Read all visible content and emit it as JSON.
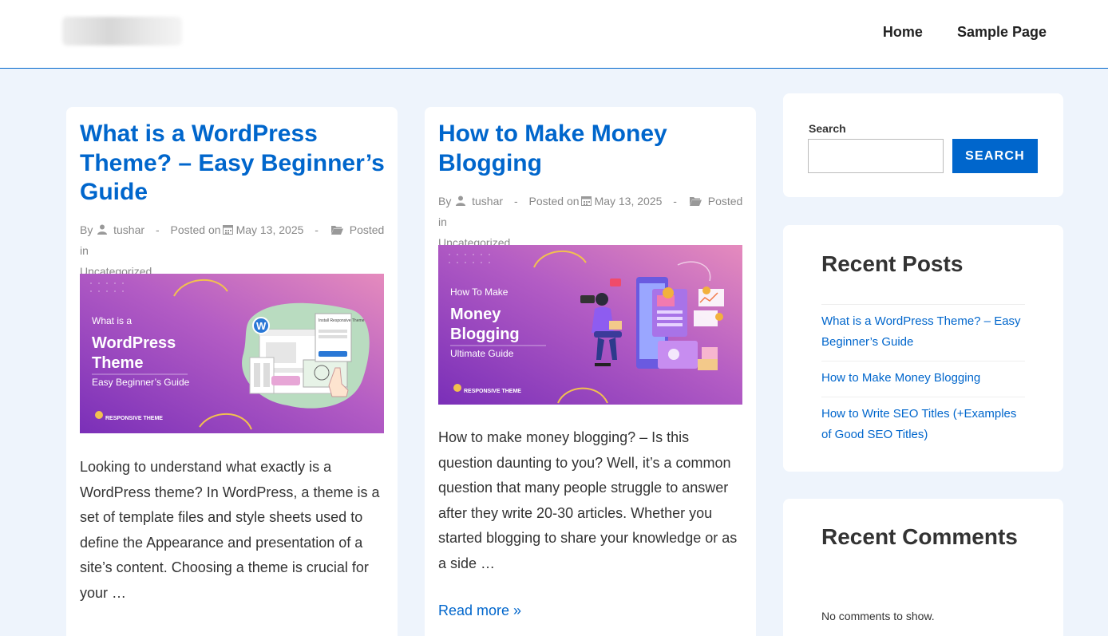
{
  "nav": {
    "items": [
      "Home",
      "Sample Page"
    ]
  },
  "posts": [
    {
      "title": "What is a WordPress Theme? – Easy Beginner’s Guide",
      "meta": {
        "by": "By",
        "author": "tushar",
        "posted_on": "Posted on",
        "date": "May 13, 2025",
        "posted_in": "Posted in",
        "category": "Uncategorized"
      },
      "image": {
        "line1": "What is a",
        "line2": "WordPress",
        "line3": "Theme",
        "line4": "Easy Beginner’s Guide",
        "brand": "RESPONSIVE THEME",
        "popup_title": "Install Responsive Theme"
      },
      "excerpt": "Looking to understand what exactly is a WordPress theme? In WordPress, a theme is a set of template files and style sheets used to define the Appearance and presentation of a site’s content.  Choosing a theme is crucial for your …"
    },
    {
      "title": "How to Make Money Blogging",
      "meta": {
        "by": "By",
        "author": "tushar",
        "posted_on": "Posted on",
        "date": "May 13, 2025",
        "posted_in": "Posted in",
        "category": "Uncategorized"
      },
      "image": {
        "line1": "How To Make",
        "line2": "Money",
        "line3": "Blogging",
        "line4": "Ultimate Guide",
        "brand": "RESPONSIVE THEME"
      },
      "excerpt": "How to make money blogging? – Is this question daunting to you? Well, it’s a common question that many people struggle to answer after they write 20-30 articles. Whether you started blogging to share your knowledge or as a side …",
      "read_more": "Read more »"
    }
  ],
  "sidebar": {
    "search": {
      "label": "Search",
      "button": "SEARCH",
      "value": ""
    },
    "recent_posts": {
      "title": "Recent Posts",
      "items": [
        "What is a WordPress Theme? – Easy Beginner’s Guide",
        "How to Make Money Blogging",
        "How to Write SEO Titles (+Examples of Good SEO Titles)"
      ]
    },
    "recent_comments": {
      "title": "Recent Comments",
      "empty": "No comments to show."
    }
  },
  "colors": {
    "accent": "#0066cc",
    "page_bg": "#eef4fc",
    "text": "#333333",
    "meta": "#888888",
    "thumb_purple": "#8a3fc4",
    "thumb_pink": "#e07fb5"
  },
  "icons": [
    "user-icon",
    "calendar-icon",
    "folder-icon"
  ]
}
